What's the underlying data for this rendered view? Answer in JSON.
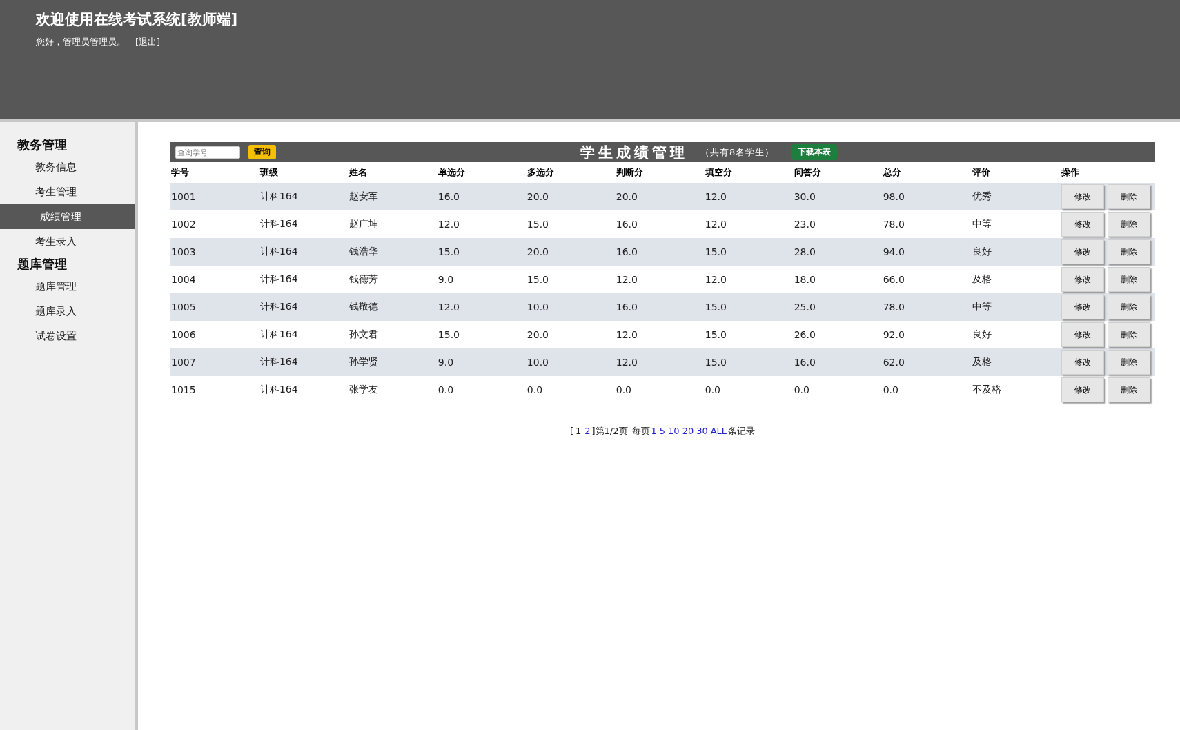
{
  "header": {
    "title": "欢迎使用在线考试系统[教师端]",
    "greeting": "您好，管理员管理员。",
    "logout": "[退出]"
  },
  "sidebar": {
    "groups": [
      {
        "title": "教务管理",
        "items": [
          {
            "label": "教务信息",
            "selected": false
          },
          {
            "label": "考生管理",
            "selected": false
          },
          {
            "label": "成绩管理",
            "selected": true
          },
          {
            "label": "考生录入",
            "selected": false
          }
        ]
      },
      {
        "title": "题库管理",
        "items": [
          {
            "label": "题库管理",
            "selected": false
          },
          {
            "label": "题库录入",
            "selected": false
          },
          {
            "label": "试卷设置",
            "selected": false
          }
        ]
      }
    ]
  },
  "toolbar": {
    "search_placeholder": "查询学号",
    "search_button": "查询",
    "title": "学生成绩管理",
    "count": "（共有8名学生）",
    "download_button": "下载本表"
  },
  "table": {
    "columns": [
      "学号",
      "班级",
      "姓名",
      "单选分",
      "多选分",
      "判断分",
      "填空分",
      "问答分",
      "总分",
      "评价",
      "操作"
    ],
    "rows": [
      {
        "cells": [
          "1001",
          "计科164",
          "赵安军",
          "16.0",
          "20.0",
          "20.0",
          "12.0",
          "30.0",
          "98.0",
          "优秀"
        ],
        "actions": [
          "修改",
          "删除"
        ]
      },
      {
        "cells": [
          "1002",
          "计科164",
          "赵广坤",
          "12.0",
          "15.0",
          "16.0",
          "12.0",
          "23.0",
          "78.0",
          "中等"
        ],
        "actions": [
          "修改",
          "删除"
        ]
      },
      {
        "cells": [
          "1003",
          "计科164",
          "钱浩华",
          "15.0",
          "20.0",
          "16.0",
          "15.0",
          "28.0",
          "94.0",
          "良好"
        ],
        "actions": [
          "修改",
          "删除"
        ]
      },
      {
        "cells": [
          "1004",
          "计科164",
          "钱德芳",
          "9.0",
          "15.0",
          "12.0",
          "12.0",
          "18.0",
          "66.0",
          "及格"
        ],
        "actions": [
          "修改",
          "删除"
        ]
      },
      {
        "cells": [
          "1005",
          "计科164",
          "钱敬德",
          "12.0",
          "10.0",
          "16.0",
          "15.0",
          "25.0",
          "78.0",
          "中等"
        ],
        "actions": [
          "修改",
          "删除"
        ]
      },
      {
        "cells": [
          "1006",
          "计科164",
          "孙文君",
          "15.0",
          "20.0",
          "12.0",
          "15.0",
          "26.0",
          "92.0",
          "良好"
        ],
        "actions": [
          "修改",
          "删除"
        ]
      },
      {
        "cells": [
          "1007",
          "计科164",
          "孙学贤",
          "9.0",
          "10.0",
          "12.0",
          "15.0",
          "16.0",
          "62.0",
          "及格"
        ],
        "actions": [
          "修改",
          "删除"
        ]
      },
      {
        "cells": [
          "1015",
          "计科164",
          "张学友",
          "0.0",
          "0.0",
          "0.0",
          "0.0",
          "0.0",
          "0.0",
          "不及格"
        ],
        "actions": [
          "修改",
          "删除"
        ]
      }
    ]
  },
  "pagination": {
    "open": "[",
    "pages": [
      {
        "label": "1",
        "selected": true
      },
      {
        "label": "2",
        "selected": false
      }
    ],
    "close": "]",
    "page_info": "第1/2页",
    "per_page_label": "每页",
    "per_page": [
      "1",
      "5",
      "10",
      "20",
      "30",
      "ALL"
    ],
    "suffix": "条记录"
  }
}
